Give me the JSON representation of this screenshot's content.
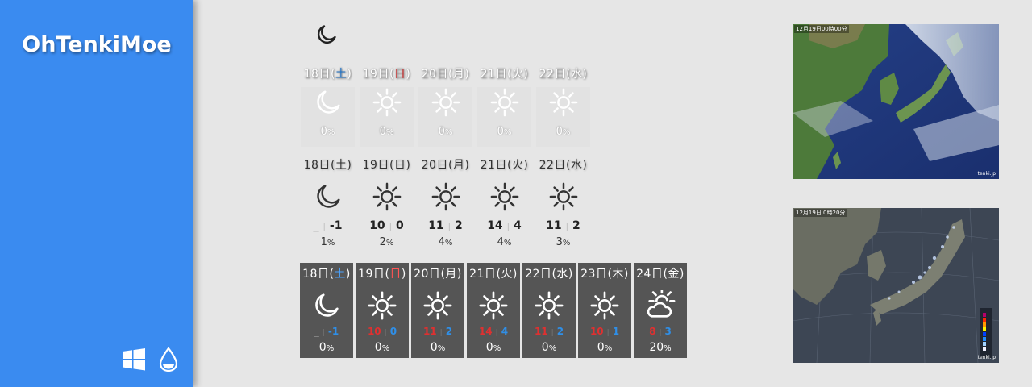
{
  "app": {
    "title": "OhTenkiMoe"
  },
  "sidebar": {
    "icons": [
      "windows-icon",
      "water-drop-icon"
    ]
  },
  "current": {
    "icon": "moon"
  },
  "forecast_row1": [
    {
      "date": "18日",
      "dow": "土",
      "dow_type": "sat",
      "icon": "moon",
      "pop": "0"
    },
    {
      "date": "19日",
      "dow": "日",
      "dow_type": "sun",
      "icon": "sun",
      "pop": "0"
    },
    {
      "date": "20日",
      "dow": "月",
      "dow_type": "weekday",
      "icon": "sun",
      "pop": "0"
    },
    {
      "date": "21日",
      "dow": "火",
      "dow_type": "weekday",
      "icon": "sun",
      "pop": "0"
    },
    {
      "date": "22日",
      "dow": "水",
      "dow_type": "weekday",
      "icon": "sun",
      "pop": "0"
    }
  ],
  "forecast_row2": [
    {
      "date": "18日",
      "dow": "土",
      "icon": "moon",
      "hi": "_",
      "lo": "-1",
      "pop": "1"
    },
    {
      "date": "19日",
      "dow": "日",
      "icon": "sun",
      "hi": "10",
      "lo": "0",
      "pop": "2"
    },
    {
      "date": "20日",
      "dow": "月",
      "icon": "sun",
      "hi": "11",
      "lo": "2",
      "pop": "4"
    },
    {
      "date": "21日",
      "dow": "火",
      "icon": "sun",
      "hi": "14",
      "lo": "4",
      "pop": "4"
    },
    {
      "date": "22日",
      "dow": "水",
      "icon": "sun",
      "hi": "11",
      "lo": "2",
      "pop": "3"
    }
  ],
  "forecast_row3": [
    {
      "date": "18日",
      "dow": "土",
      "dow_type": "sat",
      "icon": "moon",
      "hi": "_",
      "lo": "-1",
      "pop": "0"
    },
    {
      "date": "19日",
      "dow": "日",
      "dow_type": "sun",
      "icon": "sun",
      "hi": "10",
      "lo": "0",
      "pop": "0"
    },
    {
      "date": "20日",
      "dow": "月",
      "dow_type": "weekday",
      "icon": "sun",
      "hi": "11",
      "lo": "2",
      "pop": "0"
    },
    {
      "date": "21日",
      "dow": "火",
      "dow_type": "weekday",
      "icon": "sun",
      "hi": "14",
      "lo": "4",
      "pop": "0"
    },
    {
      "date": "22日",
      "dow": "水",
      "dow_type": "weekday",
      "icon": "sun",
      "hi": "11",
      "lo": "2",
      "pop": "0"
    },
    {
      "date": "23日",
      "dow": "木",
      "dow_type": "weekday",
      "icon": "sun",
      "hi": "10",
      "lo": "1",
      "pop": "0"
    },
    {
      "date": "24日",
      "dow": "金",
      "dow_type": "weekday",
      "icon": "sun-cloud",
      "hi": "8",
      "lo": "3",
      "pop": "20"
    }
  ],
  "maps": [
    {
      "kind": "satellite",
      "time": "12月19日00時00分",
      "brand": "tenki.jp"
    },
    {
      "kind": "radar",
      "time": "12月19日 0時20分",
      "brand": "tenki.jp"
    }
  ],
  "colors": {
    "sidebar": "#3a8bf0",
    "saturday": "#1e72c8",
    "sunday": "#cc2222",
    "card": "#555555",
    "high": "#e03030",
    "low": "#2f8fe8"
  }
}
